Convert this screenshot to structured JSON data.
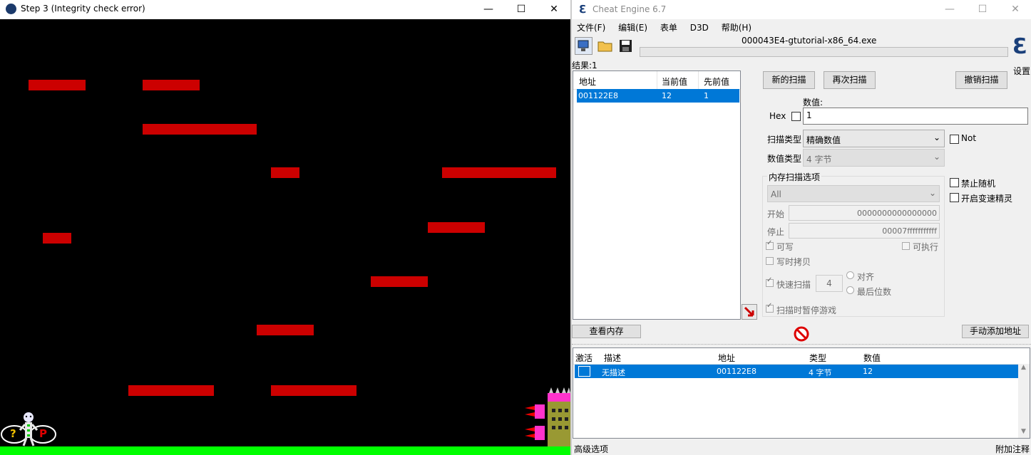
{
  "game": {
    "title": "Step 3 (Integrity check error)",
    "question_mark": "?",
    "p_label": "P"
  },
  "ce": {
    "title": "Cheat Engine 6.7",
    "menu": [
      "文件(F)",
      "编辑(E)",
      "表单",
      "D3D",
      "帮助(H)"
    ],
    "process": "000043E4-gtutorial-x86_64.exe",
    "settings_label": "设置",
    "results_label": "结果:1",
    "scan_list": {
      "headers": [
        "地址",
        "当前值",
        "先前值"
      ],
      "rows": [
        [
          "001122E8",
          "12",
          "1"
        ]
      ]
    },
    "buttons": {
      "new_scan": "新的扫描",
      "next_scan": "再次扫描",
      "undo_scan": "撤销扫描",
      "view_memory": "查看内存",
      "add_address": "手动添加地址"
    },
    "value_label": "数值:",
    "hex_label": "Hex",
    "value_input": "1",
    "scan_type_label": "扫描类型",
    "scan_type_value": "精确数值",
    "not_label": "Not",
    "value_type_label": "数值类型",
    "value_type_value": "4 字节",
    "mem_options_label": "内存扫描选项",
    "region_value": "All",
    "start_label": "开始",
    "start_value": "0000000000000000",
    "stop_label": "停止",
    "stop_value": "00007fffffffffff",
    "writable_label": "可写",
    "executable_label": "可执行",
    "copy_on_write_label": "写时拷贝",
    "fast_scan_label": "快速扫描",
    "fast_scan_value": "4",
    "align_label": "对齐",
    "last_digits_label": "最后位数",
    "pause_label": "扫描时暂停游戏",
    "no_random_label": "禁止随机",
    "speedhack_label": "开启变速精灵",
    "table": {
      "headers": [
        "激活",
        "描述",
        "地址",
        "类型",
        "数值"
      ],
      "rows": [
        [
          "",
          "无描述",
          "001122E8",
          "4 字节",
          "12"
        ]
      ]
    },
    "advanced_label": "高级选项",
    "add_comment_label": "附加注释"
  }
}
